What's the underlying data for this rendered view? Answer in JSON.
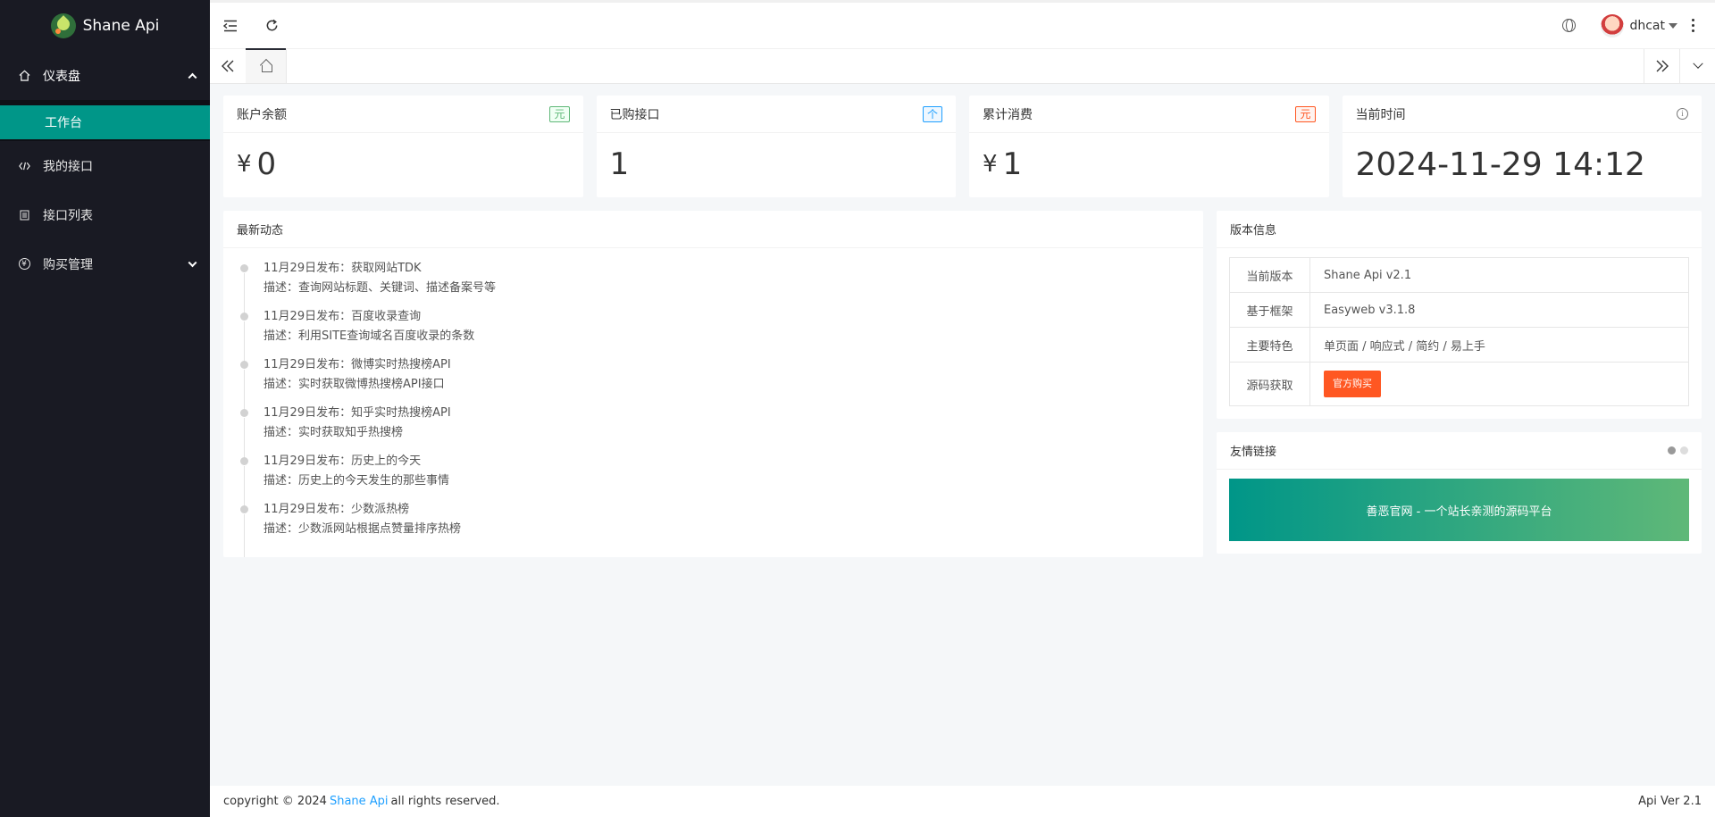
{
  "brand": {
    "name": "Shane Api"
  },
  "sidebar": {
    "dashboard": "仪表盘",
    "workbench": "工作台",
    "my_api": "我的接口",
    "api_list": "接口列表",
    "purchase": "购买管理",
    "purchase_icon_text": "¥"
  },
  "header": {
    "username": "dhcat"
  },
  "stats": [
    {
      "title": "账户余额",
      "badge": "元",
      "currency": "¥",
      "value": "0"
    },
    {
      "title": "已购接口",
      "badge": "个",
      "value": "1"
    },
    {
      "title": "累计消费",
      "badge": "元",
      "currency": "¥",
      "value": "1"
    },
    {
      "title": "当前时间",
      "value": "2024-11-29 14:12"
    }
  ],
  "news": {
    "title": "最新动态",
    "items": [
      {
        "title": "11月29日发布：获取网站TDK",
        "desc": "描述：查询网站标题、关键词、描述备案号等"
      },
      {
        "title": "11月29日发布：百度收录查询",
        "desc": "描述：利用SITE查询域名百度收录的条数"
      },
      {
        "title": "11月29日发布：微博实时热搜榜API",
        "desc": "描述：实时获取微博热搜榜API接口"
      },
      {
        "title": "11月29日发布：知乎实时热搜榜API",
        "desc": "描述：实时获取知乎热搜榜"
      },
      {
        "title": "11月29日发布：历史上的今天",
        "desc": "描述：历史上的今天发生的那些事情"
      },
      {
        "title": "11月29日发布：少数派热榜",
        "desc": "描述：少数派网站根据点赞量排序热榜"
      }
    ]
  },
  "version": {
    "title": "版本信息",
    "rows": [
      {
        "k": "当前版本",
        "v": "Shane Api v2.1"
      },
      {
        "k": "基于框架",
        "v": "Easyweb v3.1.8"
      },
      {
        "k": "主要特色",
        "v": "单页面 / 响应式 / 简约 / 易上手"
      },
      {
        "k": "源码获取",
        "btn": "官方购买"
      }
    ]
  },
  "links": {
    "title": "友情链接",
    "banner": "善恶官网 - 一个站长亲测的源码平台"
  },
  "footer": {
    "prefix": "copyright © 2024",
    "link": "Shane Api",
    "suffix": "all rights reserved.",
    "version": "Api Ver 2.1"
  },
  "colors": {
    "sidebar_bg": "#191a23",
    "accent": "#009688",
    "danger": "#ff5722",
    "info": "#1e9fff",
    "success": "#5fb878"
  }
}
